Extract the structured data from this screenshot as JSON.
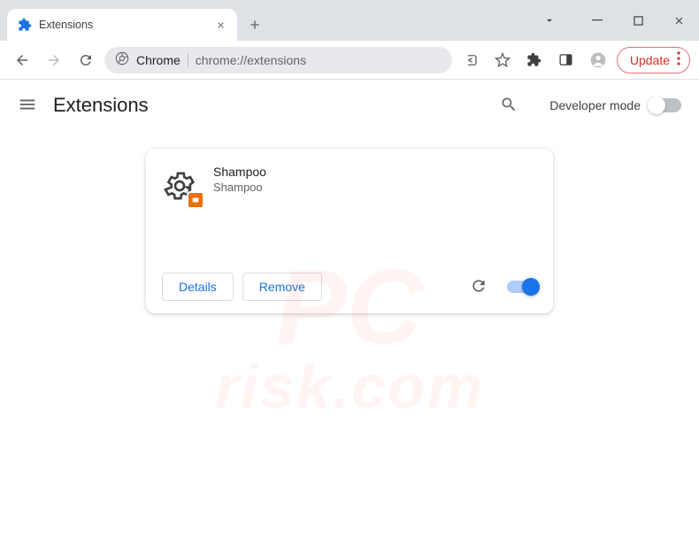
{
  "tab": {
    "title": "Extensions"
  },
  "omnibox": {
    "label": "Chrome",
    "url": "chrome://extensions"
  },
  "toolbar": {
    "update_label": "Update"
  },
  "page": {
    "title": "Extensions",
    "developer_mode_label": "Developer mode",
    "developer_mode_on": false
  },
  "extension": {
    "name": "Shampoo",
    "description": "Shampoo",
    "details_label": "Details",
    "remove_label": "Remove",
    "enabled": true
  },
  "watermark": {
    "line1": "PC",
    "line2": "risk.com"
  }
}
